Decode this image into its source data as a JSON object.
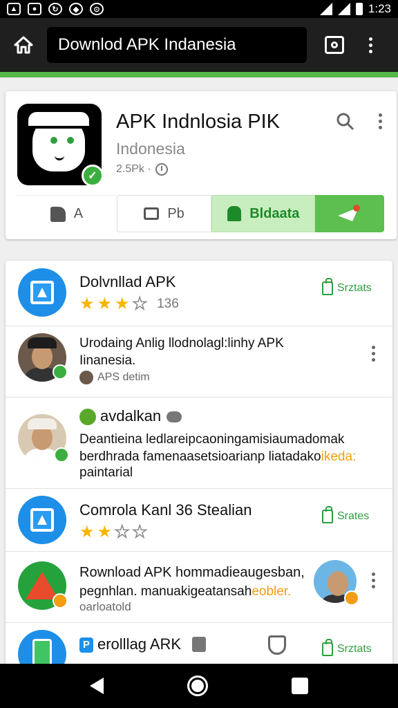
{
  "status_bar": {
    "time": "1:23"
  },
  "toolbar": {
    "url_title": "Downlod APK Indanesia"
  },
  "app": {
    "title": "APK Indnlosia PIK",
    "subtitle": "Indonesia",
    "meta": "2.5Pk ·",
    "actions": [
      {
        "label": "A"
      },
      {
        "label": "Pb"
      },
      {
        "label": "Bldaata"
      }
    ]
  },
  "list": [
    {
      "title": "Dolvnllad APK",
      "rating": 3,
      "count": "136",
      "install_label": "Srztats"
    },
    {
      "text_line1": "Urodaing Anlig llodnolagl:linhy APK",
      "text_line2": "Iinanesia.",
      "sub": "APS detim"
    },
    {
      "title": "avdalkan",
      "text_line1": "Deantieina ledlareipcaoningamisiaumadomak",
      "text_line2_a": "berdhrada famenaasetsioarianp liatadako",
      "text_line2_highlight": "ikeda:",
      "text_line3": "paintarial"
    },
    {
      "title": "Comrola Kanl 36 Stealian",
      "rating": 2,
      "install_label": "Srates"
    },
    {
      "text_line1": "Rownload APK hommadieaugesban,",
      "text_line2_a": "pegnhlan. manuakigeatansah",
      "text_line2_highlight": "eobler.",
      "text_line3": "oarloatold"
    },
    {
      "title": "erolllag ARK",
      "install_label": "Srztats"
    }
  ],
  "colors": {
    "accent_green": "#54b948",
    "toolbar_bg": "#1f1f1f",
    "icon_blue": "#1e8fe8"
  }
}
